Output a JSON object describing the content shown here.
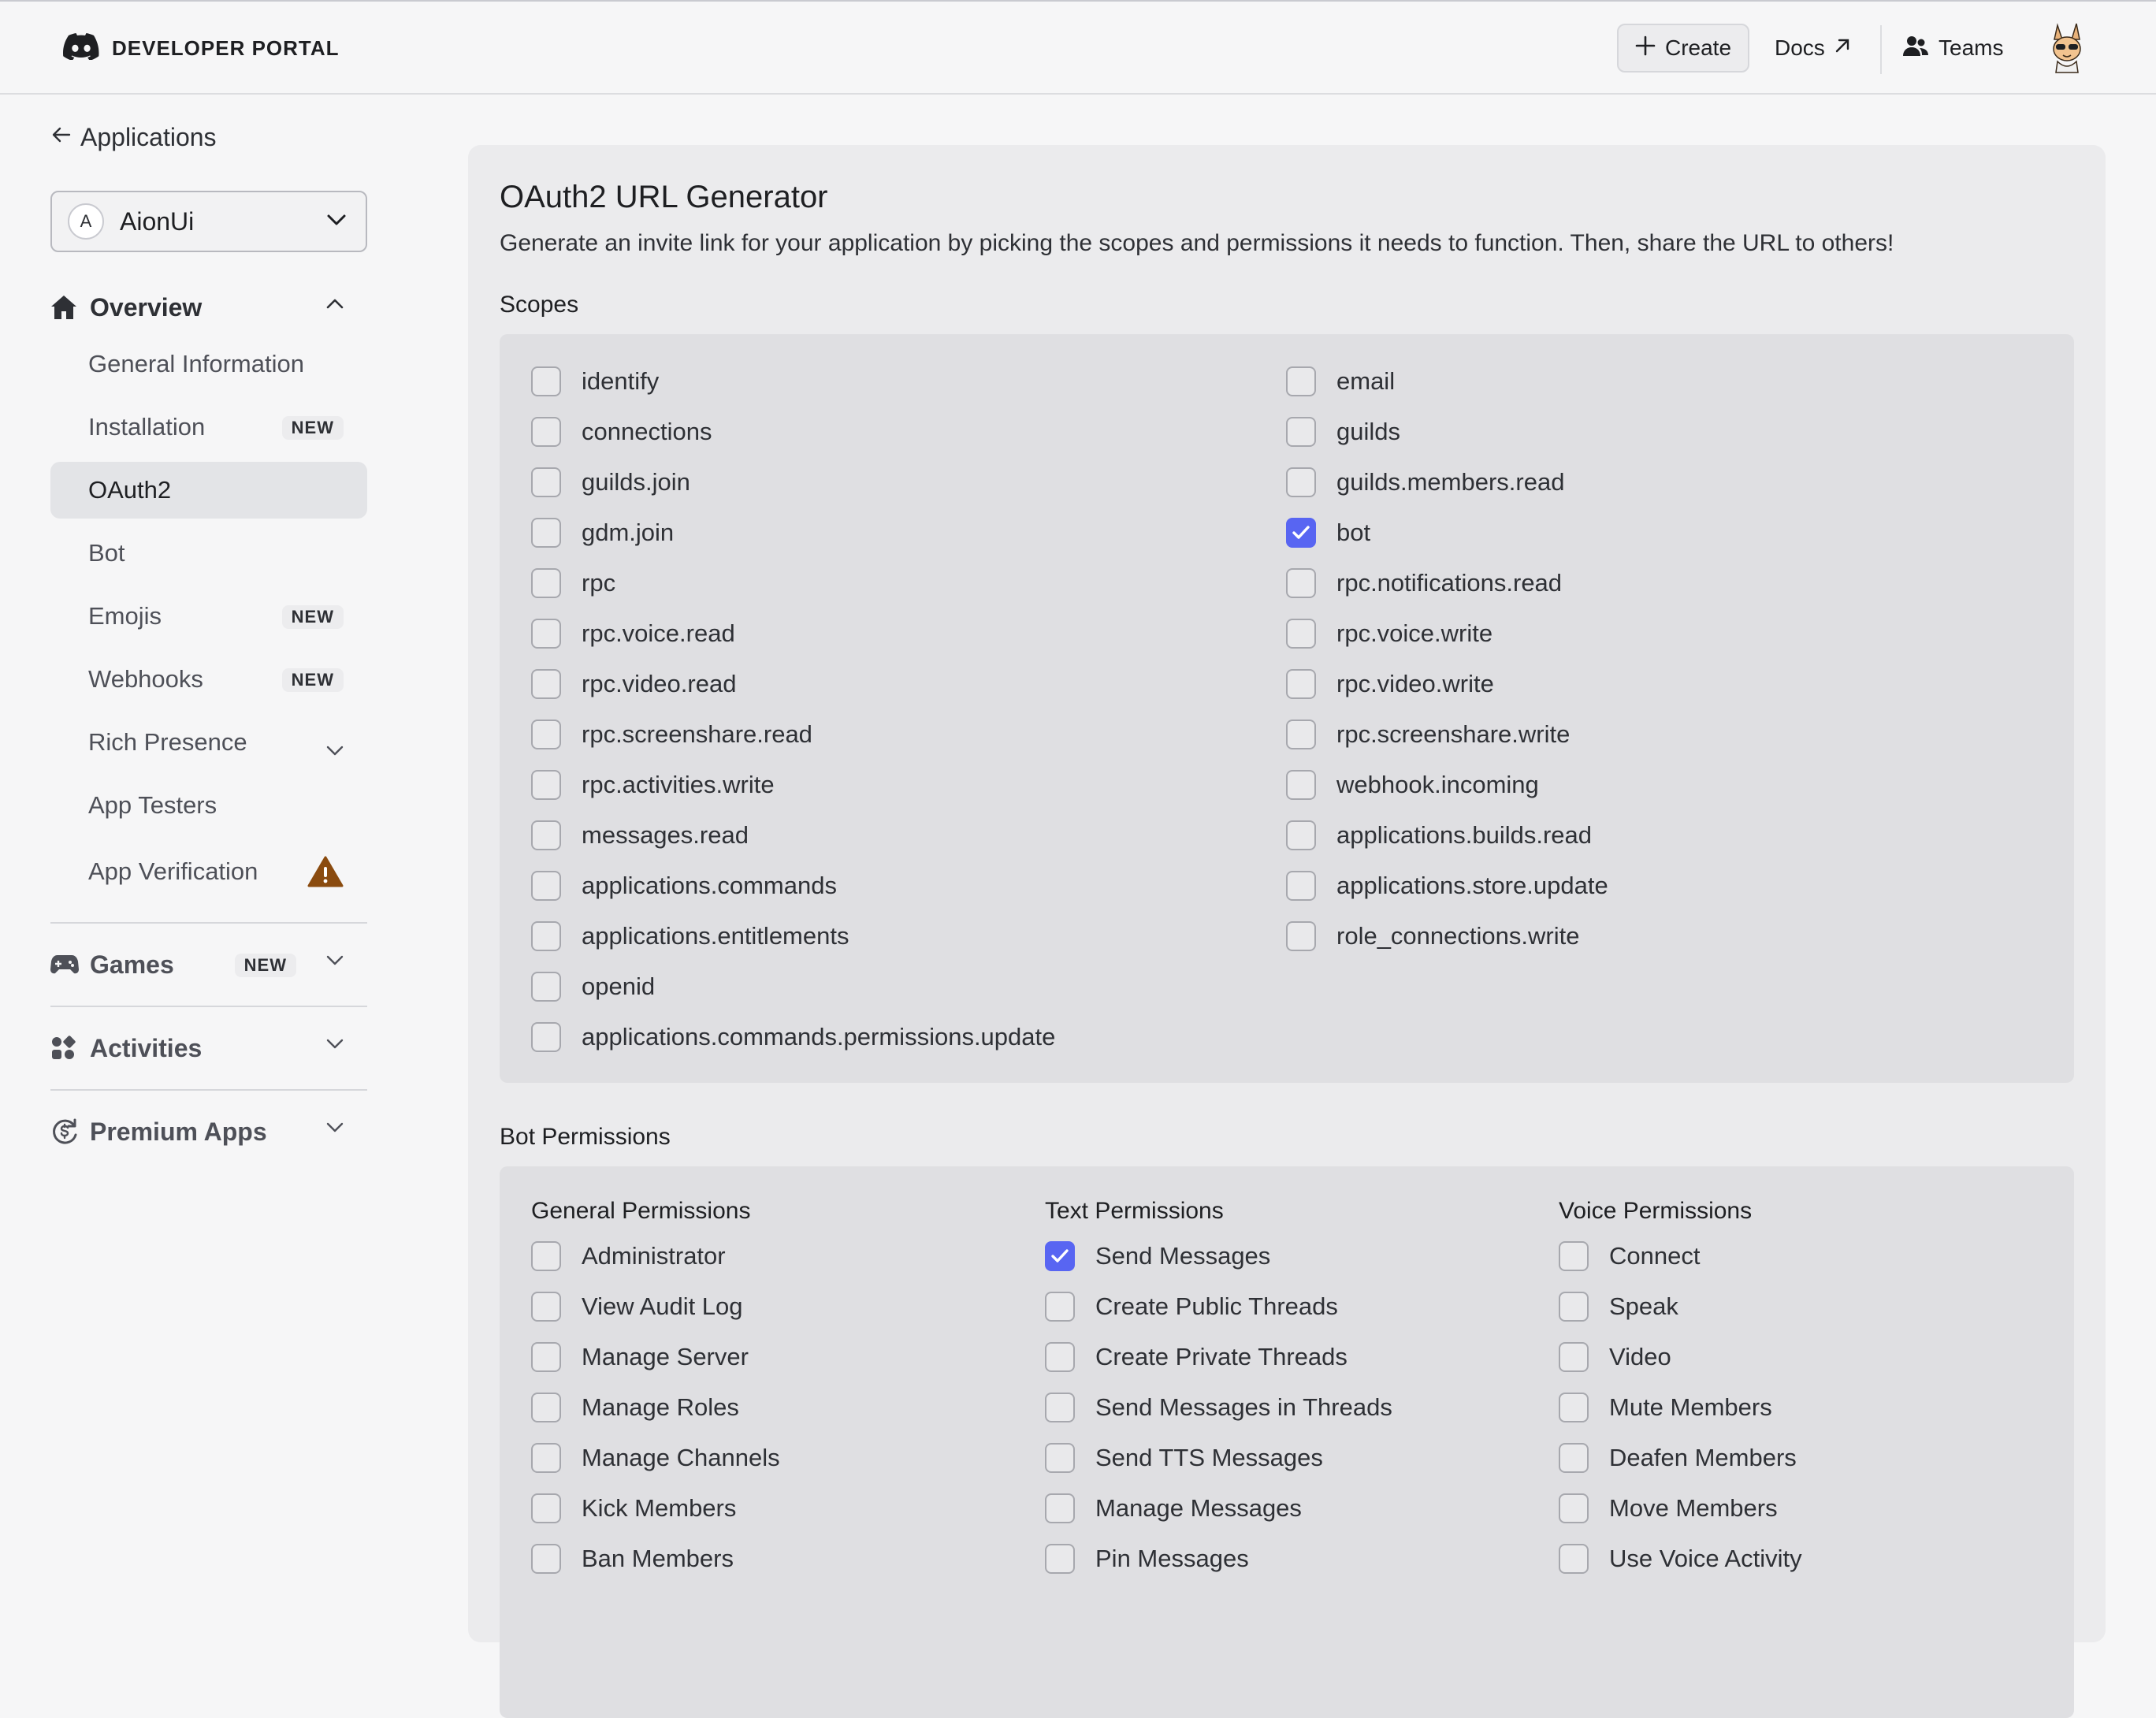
{
  "header": {
    "brand": "DEVELOPER PORTAL",
    "create_label": "Create",
    "docs_label": "Docs",
    "teams_label": "Teams"
  },
  "sidebar": {
    "back_label": "Applications",
    "app": {
      "initial": "A",
      "name": "AionUi"
    },
    "overview_label": "Overview",
    "items": [
      {
        "label": "General Information"
      },
      {
        "label": "Installation",
        "badge": "NEW"
      },
      {
        "label": "OAuth2"
      },
      {
        "label": "Bot"
      },
      {
        "label": "Emojis",
        "badge": "NEW"
      },
      {
        "label": "Webhooks",
        "badge": "NEW"
      },
      {
        "label": "Rich Presence"
      },
      {
        "label": "App Testers"
      },
      {
        "label": "App Verification"
      }
    ],
    "games": {
      "label": "Games",
      "badge": "NEW"
    },
    "activities_label": "Activities",
    "premium_label": "Premium Apps"
  },
  "main": {
    "title": "OAuth2 URL Generator",
    "description": "Generate an invite link for your application by picking the scopes and permissions it needs to function. Then, share the URL to others!",
    "scopes_label": "Scopes",
    "scopes_left": [
      {
        "label": "identify",
        "checked": false
      },
      {
        "label": "connections",
        "checked": false
      },
      {
        "label": "guilds.join",
        "checked": false
      },
      {
        "label": "gdm.join",
        "checked": false
      },
      {
        "label": "rpc",
        "checked": false
      },
      {
        "label": "rpc.voice.read",
        "checked": false
      },
      {
        "label": "rpc.video.read",
        "checked": false
      },
      {
        "label": "rpc.screenshare.read",
        "checked": false
      },
      {
        "label": "rpc.activities.write",
        "checked": false
      },
      {
        "label": "messages.read",
        "checked": false
      },
      {
        "label": "applications.commands",
        "checked": false
      },
      {
        "label": "applications.entitlements",
        "checked": false
      },
      {
        "label": "openid",
        "checked": false
      },
      {
        "label": "applications.commands.permissions.update",
        "checked": false
      }
    ],
    "scopes_right": [
      {
        "label": "email",
        "checked": false
      },
      {
        "label": "guilds",
        "checked": false
      },
      {
        "label": "guilds.members.read",
        "checked": false
      },
      {
        "label": "bot",
        "checked": true
      },
      {
        "label": "rpc.notifications.read",
        "checked": false
      },
      {
        "label": "rpc.voice.write",
        "checked": false
      },
      {
        "label": "rpc.video.write",
        "checked": false
      },
      {
        "label": "rpc.screenshare.write",
        "checked": false
      },
      {
        "label": "webhook.incoming",
        "checked": false
      },
      {
        "label": "applications.builds.read",
        "checked": false
      },
      {
        "label": "applications.store.update",
        "checked": false
      },
      {
        "label": "role_connections.write",
        "checked": false
      }
    ],
    "bot_permissions_label": "Bot Permissions",
    "permission_groups": [
      {
        "title": "General Permissions",
        "items": [
          {
            "label": "Administrator",
            "checked": false
          },
          {
            "label": "View Audit Log",
            "checked": false
          },
          {
            "label": "Manage Server",
            "checked": false
          },
          {
            "label": "Manage Roles",
            "checked": false
          },
          {
            "label": "Manage Channels",
            "checked": false
          },
          {
            "label": "Kick Members",
            "checked": false
          },
          {
            "label": "Ban Members",
            "checked": false
          }
        ]
      },
      {
        "title": "Text Permissions",
        "items": [
          {
            "label": "Send Messages",
            "checked": true
          },
          {
            "label": "Create Public Threads",
            "checked": false
          },
          {
            "label": "Create Private Threads",
            "checked": false
          },
          {
            "label": "Send Messages in Threads",
            "checked": false
          },
          {
            "label": "Send TTS Messages",
            "checked": false
          },
          {
            "label": "Manage Messages",
            "checked": false
          },
          {
            "label": "Pin Messages",
            "checked": false
          }
        ]
      },
      {
        "title": "Voice Permissions",
        "items": [
          {
            "label": "Connect",
            "checked": false
          },
          {
            "label": "Speak",
            "checked": false
          },
          {
            "label": "Video",
            "checked": false
          },
          {
            "label": "Mute Members",
            "checked": false
          },
          {
            "label": "Deafen Members",
            "checked": false
          },
          {
            "label": "Move Members",
            "checked": false
          },
          {
            "label": "Use Voice Activity",
            "checked": false
          }
        ]
      }
    ]
  },
  "colors": {
    "accent": "#5865f2",
    "warning": "#8a4b0f"
  }
}
